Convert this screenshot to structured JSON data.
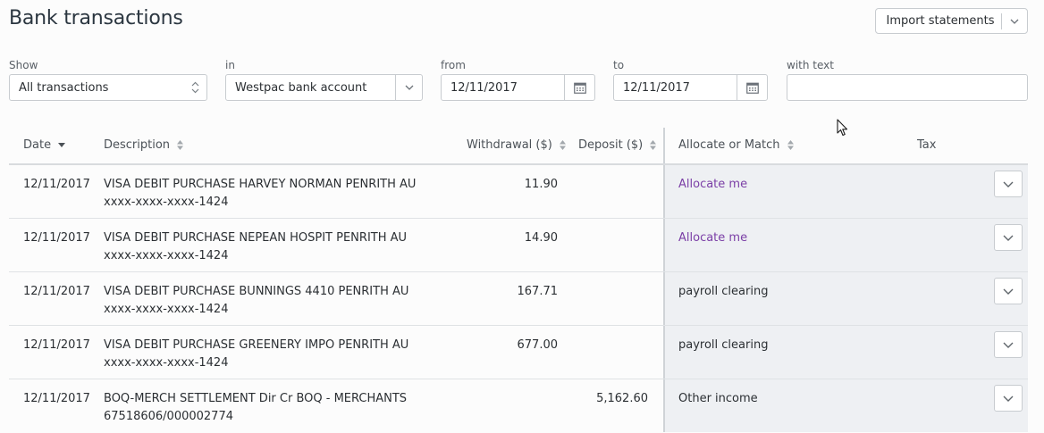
{
  "page": {
    "title": "Bank transactions",
    "import_button": "Import statements"
  },
  "filters": {
    "show": {
      "label": "Show",
      "value": "All transactions"
    },
    "in": {
      "label": "in",
      "value": "Westpac bank account"
    },
    "from": {
      "label": "from",
      "value": "12/11/2017"
    },
    "to": {
      "label": "to",
      "value": "12/11/2017"
    },
    "with_text": {
      "label": "with text",
      "value": ""
    }
  },
  "table": {
    "columns": {
      "date": "Date",
      "description": "Description",
      "withdrawal": "Withdrawal ($)",
      "deposit": "Deposit ($)",
      "allocate": "Allocate or Match",
      "tax": "Tax"
    },
    "rows": [
      {
        "date": "12/11/2017",
        "desc1": "VISA DEBIT PURCHASE HARVEY NORMAN PENRITH AU",
        "desc2": "xxxx-xxxx-xxxx-1424",
        "withdrawal": "11.90",
        "deposit": "",
        "allocate": "Allocate me",
        "allocate_is_link": true
      },
      {
        "date": "12/11/2017",
        "desc1": "VISA DEBIT PURCHASE NEPEAN HOSPIT PENRITH AU",
        "desc2": "xxxx-xxxx-xxxx-1424",
        "withdrawal": "14.90",
        "deposit": "",
        "allocate": "Allocate me",
        "allocate_is_link": true
      },
      {
        "date": "12/11/2017",
        "desc1": "VISA DEBIT PURCHASE BUNNINGS 4410 PENRITH AU",
        "desc2": "xxxx-xxxx-xxxx-1424",
        "withdrawal": "167.71",
        "deposit": "",
        "allocate": "payroll clearing",
        "allocate_is_link": false
      },
      {
        "date": "12/11/2017",
        "desc1": "VISA DEBIT PURCHASE GREENERY IMPO PENRITH AU",
        "desc2": "xxxx-xxxx-xxxx-1424",
        "withdrawal": "677.00",
        "deposit": "",
        "allocate": "payroll clearing",
        "allocate_is_link": false
      },
      {
        "date": "12/11/2017",
        "desc1": "BOQ-MERCH SETTLEMENT Dir Cr BOQ - MERCHANTS",
        "desc2": "67518606/000002774",
        "withdrawal": "",
        "deposit": "5,162.60",
        "allocate": "Other income",
        "allocate_is_link": false
      }
    ]
  },
  "colors": {
    "link": "#7b3fa6",
    "allocate_bg": "#eef0f3"
  }
}
